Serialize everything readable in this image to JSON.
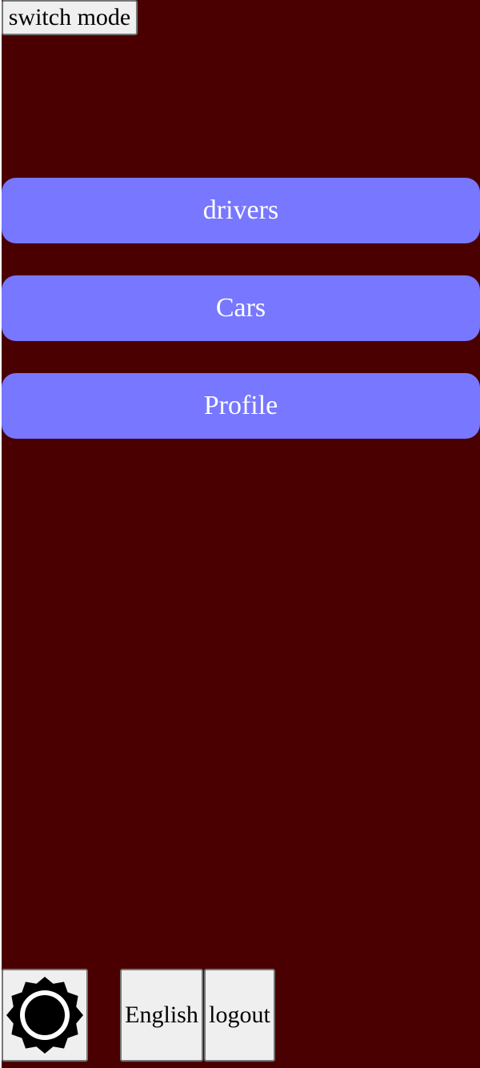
{
  "header": {
    "switch_mode_label": "switch mode"
  },
  "nav": {
    "items": [
      {
        "label": "drivers"
      },
      {
        "label": "Cars"
      },
      {
        "label": "Profile"
      }
    ]
  },
  "footer": {
    "theme_icon": "sun-icon",
    "language_label": "English",
    "logout_label": "logout"
  },
  "colors": {
    "background": "#4a0000",
    "nav_button": "#7777ff",
    "nav_text": "#ffffff",
    "system_button": "#efefef"
  }
}
